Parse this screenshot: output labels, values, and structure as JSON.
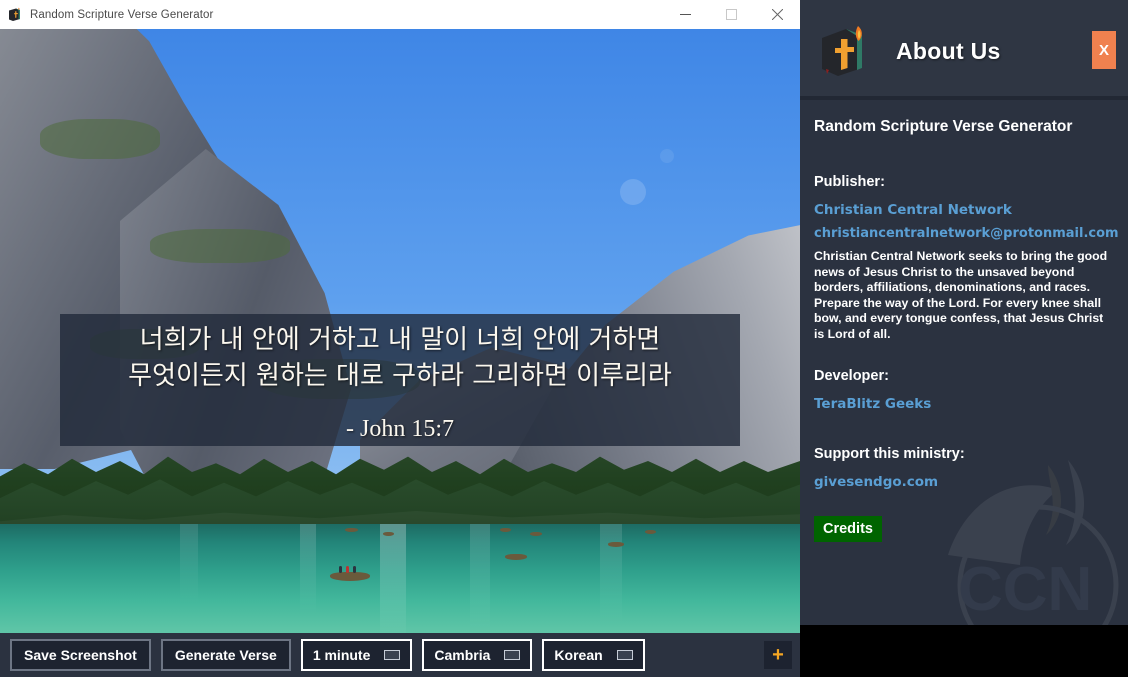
{
  "window": {
    "title": "Random Scripture Verse Generator",
    "icon": "book-flame-icon",
    "controls": {
      "minimize": "minimize-icon",
      "maximize": "maximize-icon",
      "close": "close-icon"
    }
  },
  "verse": {
    "text": "너희가 내 안에 거하고 내 말이 너희 안에 거하면\n무엇이든지 원하는 대로 구하라 그리하면 이루리라",
    "reference": "- John 15:7"
  },
  "toolbar": {
    "save_screenshot": "Save Screenshot",
    "generate_verse": "Generate Verse",
    "interval": "1 minute",
    "font": "Cambria",
    "language": "Korean",
    "plus": "+",
    "plus_color": "#f5a623"
  },
  "about": {
    "header_title": "About Us",
    "logo": "book-flame-icon",
    "close_label": "X",
    "close_color": "#f0814f",
    "app_name": "Random Scripture Verse Generator",
    "publisher_heading": "Publisher:",
    "publisher_name": "Christian Central Network",
    "publisher_email": "christiancentralnetwork@protonmail.com",
    "mission": "Christian Central Network seeks to bring the good news of Jesus Christ to the unsaved beyond borders, affiliations, denominations, and races. Prepare the way of the Lord. For every knee shall bow, and every tongue confess, that Jesus Christ is Lord of all.",
    "developer_heading": "Developer:",
    "developer_name": "TeraBlitz Geeks",
    "support_heading": "Support this ministry:",
    "support_link": "givesendgo.com",
    "credits_label": "Credits",
    "credits_color": "#006400",
    "link_color": "#5a9fd4",
    "watermark": "ccn-dove-flame-watermark"
  }
}
